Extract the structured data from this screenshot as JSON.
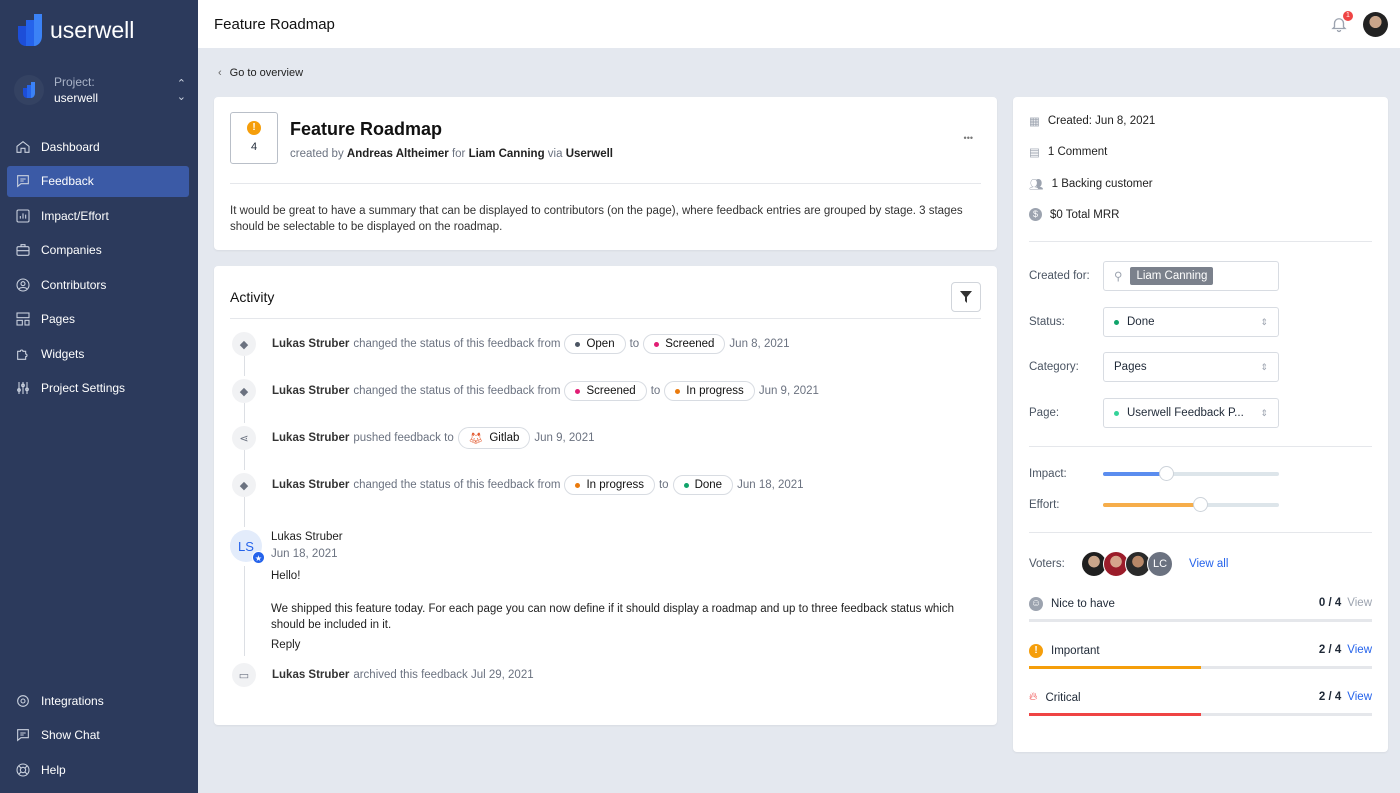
{
  "brand": {
    "name": "userwell",
    "accent": "#2563eb"
  },
  "project": {
    "label": "Project:",
    "name": "userwell"
  },
  "sidebar": {
    "items": [
      {
        "label": "Dashboard",
        "icon": "home-icon"
      },
      {
        "label": "Feedback",
        "icon": "chat-icon",
        "active": true
      },
      {
        "label": "Impact/Effort",
        "icon": "chart-icon"
      },
      {
        "label": "Companies",
        "icon": "briefcase-icon"
      },
      {
        "label": "Contributors",
        "icon": "user-circle-icon"
      },
      {
        "label": "Pages",
        "icon": "pages-icon"
      },
      {
        "label": "Widgets",
        "icon": "puzzle-icon"
      },
      {
        "label": "Project Settings",
        "icon": "sliders-icon"
      }
    ],
    "bottom": [
      {
        "label": "Integrations",
        "icon": "gear-icon"
      },
      {
        "label": "Show Chat",
        "icon": "chat-icon"
      },
      {
        "label": "Help",
        "icon": "lifebuoy-icon"
      }
    ]
  },
  "header": {
    "title": "Feature Roadmap",
    "notifications": "1"
  },
  "back_link": "Go to overview",
  "feedback": {
    "votes": "4",
    "title": "Feature Roadmap",
    "created_by_label": "created by",
    "author": "Andreas Altheimer",
    "for_label": "for",
    "customer": "Liam Canning",
    "via_label": "via",
    "source": "Userwell",
    "more": "•••",
    "description": "It would be great to have a summary that can be displayed to contributors (on the page), where feedback entries are grouped by stage. 3 stages should be selectable to be displayed on the roadmap."
  },
  "activity": {
    "title": "Activity",
    "events": [
      {
        "user": "Lukas Struber",
        "text": "changed the status of this feedback from",
        "from": "Open",
        "from_color": "#4b5563",
        "to_label": "to",
        "to": "Screened",
        "to_color": "#e11d74",
        "date": "Jun 8, 2021"
      },
      {
        "user": "Lukas Struber",
        "text": "changed the status of this feedback from",
        "from": "Screened",
        "from_color": "#e11d74",
        "to_label": "to",
        "to": "In progress",
        "to_color": "#ea7a0c",
        "date": "Jun 9, 2021"
      },
      {
        "user": "Lukas Struber",
        "text": "pushed feedback to",
        "target": "Gitlab",
        "date": "Jun 9, 2021"
      },
      {
        "user": "Lukas Struber",
        "text": "changed the status of this feedback from",
        "from": "In progress",
        "from_color": "#ea7a0c",
        "to_label": "to",
        "to": "Done",
        "to_color": "#10a36a",
        "date": "Jun 18, 2021"
      }
    ],
    "comment": {
      "initials": "LS",
      "user": "Lukas Struber",
      "date": "Jun 18, 2021",
      "line1": "Hello!",
      "line2": "We shipped this feature today. For each page you can now define if it should display a roadmap and up to three feedback status which should be included in it.",
      "reply": "Reply"
    },
    "archived": {
      "user": "Lukas Struber",
      "text": "archived this feedback Jul 29, 2021"
    }
  },
  "details": {
    "created": "Created: Jun 8, 2021",
    "comments": "1 Comment",
    "backing": "1 Backing customer",
    "mrr": "$0 Total MRR",
    "created_for_label": "Created for:",
    "created_for": "Liam Canning",
    "status_label": "Status:",
    "status": "Done",
    "status_color": "#10a36a",
    "category_label": "Category:",
    "category": "Pages",
    "page_label": "Page:",
    "page": "Userwell Feedback P...",
    "page_color": "#34d399",
    "impact_label": "Impact:",
    "impact": 0.36,
    "effort_label": "Effort:",
    "effort": 0.55,
    "voters_label": "Voters:",
    "voter_initials": "LC",
    "view_all": "View all",
    "priorities": [
      {
        "name": "Nice to have",
        "count": "0 / 4",
        "view": "View",
        "fraction": 0,
        "color": "#9ca3af",
        "icon": "smile-icon"
      },
      {
        "name": "Important",
        "count": "2 / 4",
        "view": "View",
        "fraction": 0.5,
        "color": "#f59e0b",
        "icon": "exclamation-icon"
      },
      {
        "name": "Critical",
        "count": "2 / 4",
        "view": "View",
        "fraction": 0.5,
        "color": "#ef4444",
        "icon": "fire-icon"
      }
    ]
  }
}
